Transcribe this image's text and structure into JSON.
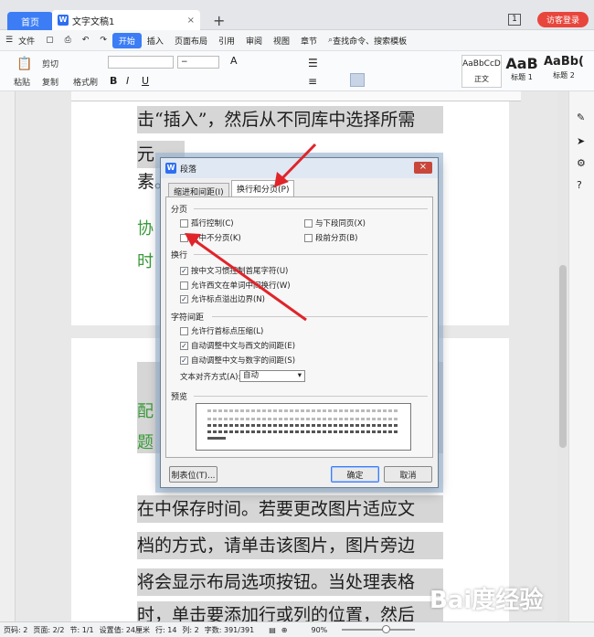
{
  "tabs": {
    "home": "首页",
    "doc": "文字文稿1",
    "plus": "+"
  },
  "header": {
    "window_count": "1",
    "visitor_login": "访客登录"
  },
  "menu": {
    "file": "文件",
    "items": [
      "开始",
      "插入",
      "页面布局",
      "引用",
      "审阅",
      "视图",
      "章节"
    ],
    "search": "查找命令、搜索模板"
  },
  "ribbon": {
    "paste": "粘贴",
    "cut": "剪切",
    "copy": "复制",
    "format_painter": "格式刷",
    "bold": "B",
    "italic": "I",
    "underline": "U",
    "font_size_sample": "A",
    "styles": [
      {
        "sample": "AaBbCcD",
        "name": "正文"
      },
      {
        "sample": "AaB",
        "name": "标题 1"
      },
      {
        "sample": "AaBb(",
        "name": "标题 2"
      }
    ]
  },
  "ruler": {
    "marks": [
      "6",
      "4",
      "2",
      "2",
      "4",
      "6",
      "8",
      "10",
      "12",
      "14",
      "16",
      "18",
      "20",
      "22",
      "24",
      "26",
      "28",
      "30",
      "32",
      "34",
      "36",
      "38"
    ]
  },
  "document": {
    "line1": "击“插入”，然后从不同库中选择所需",
    "line2": "元素。",
    "green1": "协",
    "green2": "时",
    "green3": "配",
    "green4": "题",
    "para1": "在中保存时间。若要更改图片适应文",
    "para2": "档的方式，请单击该图片，图片旁边",
    "para3": "将会显示布局选项按钮。当处理表格",
    "para4": "时，单击要添加行或列的位置，然后"
  },
  "dialog": {
    "title": "段落",
    "tab_indent": "缩进和间距(I)",
    "tab_break": "换行和分页(P)",
    "sec_pagination": "分页",
    "widow": "孤行控制(C)",
    "keep_next": "与下段同页(X)",
    "keep_lines": "段中不分页(K)",
    "page_break_before": "段前分页(B)",
    "sec_linebreak": "换行",
    "cjk_rules": "按中文习惯控制首尾字符(U)",
    "word_wrap": "允许西文在单词中间换行(W)",
    "punct_overflow": "允许标点溢出边界(N)",
    "sec_char_spacing": "字符间距",
    "compress_punct": "允许行首标点压缩(L)",
    "auto_cjk_latin": "自动调整中文与西文的间距(E)",
    "auto_cjk_num": "自动调整中文与数字的间距(S)",
    "text_align_label": "文本对齐方式(A):",
    "text_align_value": "自动",
    "sec_preview": "预览",
    "tabs_button": "制表位(T)...",
    "ok": "确定",
    "cancel": "取消",
    "checked": {
      "widow": false,
      "keep_next": false,
      "keep_lines": false,
      "page_break_before": false,
      "cjk_rules": true,
      "word_wrap": false,
      "punct_overflow": true,
      "compress_punct": false,
      "auto_cjk_latin": true,
      "auto_cjk_num": true
    }
  },
  "status": {
    "page_num": "页码: 2",
    "pages": "页面: 2/2",
    "section": "节: 1/1",
    "setting": "设置值: 24厘米",
    "row": "行: 14",
    "col": "列: 2",
    "words": "字数: 391/391",
    "zoom": "90%"
  },
  "watermark": "Bai度经验",
  "colors": {
    "accent": "#3c7df6",
    "arrow": "#e0242a",
    "green_text": "#3a9a3a"
  }
}
